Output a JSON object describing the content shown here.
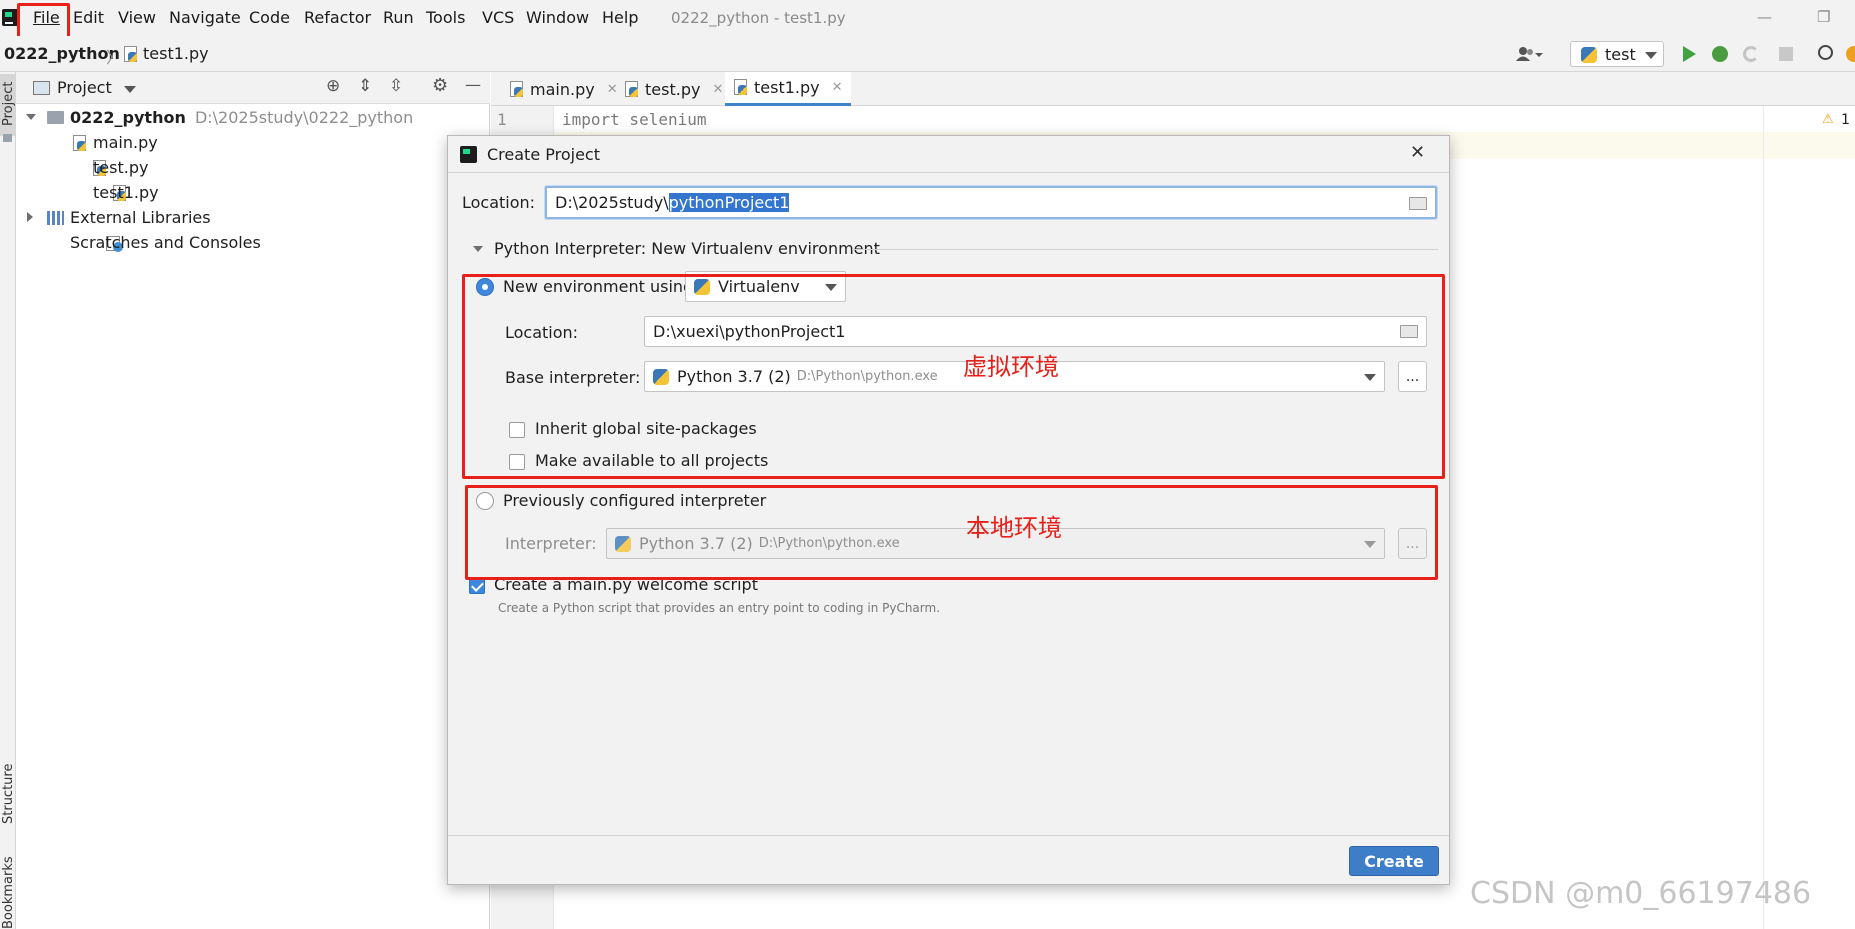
{
  "menu": [
    "File",
    "Edit",
    "View",
    "Navigate",
    "Code",
    "Refactor",
    "Run",
    "Tools",
    "VCS",
    "Window",
    "Help"
  ],
  "window_title": "0222_python - test1.py",
  "breadcrumb": {
    "project": "0222_python",
    "file": "test1.py"
  },
  "run_config": "test",
  "project_panel": {
    "title": "Project",
    "root": {
      "name": "0222_python",
      "path": "D:\\2025study\\0222_python"
    },
    "files": [
      "main.py",
      "test.py",
      "test1.py"
    ],
    "external": "External Libraries",
    "scratches": "Scratches and Consoles"
  },
  "left_strip": {
    "project": "Project",
    "structure": "Structure",
    "bookmarks": "Bookmarks"
  },
  "editor": {
    "tabs": [
      "main.py",
      "test.py",
      "test1.py"
    ],
    "active_tab": "test1.py",
    "line_no": "1",
    "code_line": "import selenium",
    "warnings": "1"
  },
  "dialog": {
    "title": "Create Project",
    "location_label": "Location:",
    "location_prefix": "D:\\2025study\\",
    "location_selected": "pythonProject1",
    "interpreter_section": "Python Interpreter: New Virtualenv environment",
    "new_env": {
      "label": "New environment using",
      "tool": "Virtualenv",
      "location_label": "Location:",
      "location": "D:\\xuexi\\pythonProject1",
      "base_label": "Base interpreter:",
      "base_name": "Python 3.7 (2)",
      "base_path": "D:\\Python\\python.exe",
      "inherit": "Inherit global site-packages",
      "make_available": "Make available to all projects"
    },
    "prev": {
      "label": "Previously configured interpreter",
      "interp_label": "Interpreter:",
      "interp_name": "Python 3.7 (2)",
      "interp_path": "D:\\Python\\python.exe"
    },
    "welcome": {
      "label": "Create a main.py welcome script",
      "hint": "Create a Python script that provides an entry point to coding in PyCharm.",
      "checked": true
    },
    "create_button": "Create",
    "dots": "..."
  },
  "annotations": {
    "virtual": "虚拟环境",
    "local": "本地环境"
  },
  "watermark": "CSDN @m0_66197486",
  "colors": {
    "annotation_red": "#e8201a",
    "accent_blue": "#3e7ec8",
    "run_green": "#3ea340"
  }
}
